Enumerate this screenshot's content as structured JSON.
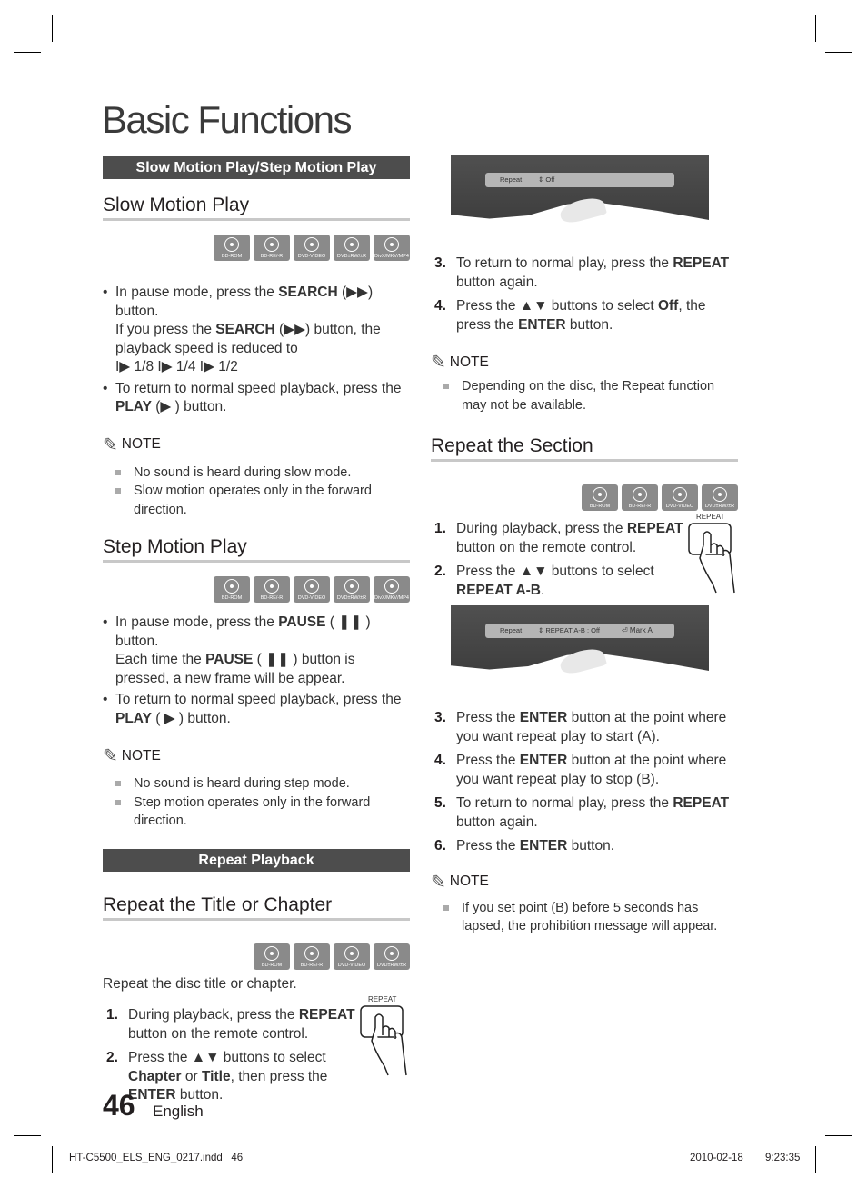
{
  "page_title": "Basic Functions",
  "left": {
    "banner1": "Slow Motion Play/Step Motion Play",
    "slow": {
      "heading": "Slow Motion Play",
      "discs": [
        "BD-ROM",
        "BD-RE/-R",
        "DVD-VIDEO",
        "DVD±RW/±R",
        "DivX/MKV/MP4"
      ],
      "b1_pre": "In pause mode, press the ",
      "b1_bold": "SEARCH",
      "b1_post": " (▶▶) button.",
      "b1_line2_pre": "If you press the ",
      "b1_line2_bold": "SEARCH",
      "b1_line2_post": " (▶▶) button, the playback speed is reduced to",
      "b1_speeds": "I▶ 1/8 I▶ 1/4 I▶ 1/2",
      "b2_pre": "To return to normal speed playback, press the ",
      "b2_bold": "PLAY",
      "b2_post": " (▶ ) button.",
      "note_label": "NOTE",
      "notes": [
        "No sound is heard during slow mode.",
        "Slow motion operates only in the forward direction."
      ]
    },
    "step": {
      "heading": "Step Motion Play",
      "discs": [
        "BD-ROM",
        "BD-RE/-R",
        "DVD-VIDEO",
        "DVD±RW/±R",
        "DivX/MKV/MP4"
      ],
      "b1_pre": "In pause mode, press the ",
      "b1_bold": "PAUSE",
      "b1_post": " ( ❚❚ ) button.",
      "b1_line2_pre": "Each time the ",
      "b1_line2_bold": "PAUSE",
      "b1_line2_post": " ( ❚❚ ) button is pressed, a new frame will be appear.",
      "b2_pre": "To return to normal speed playback, press the ",
      "b2_bold": "PLAY",
      "b2_post": " ( ▶ ) button.",
      "note_label": "NOTE",
      "notes": [
        "No sound is heard during step mode.",
        "Step motion operates only in the forward direction."
      ]
    },
    "banner2": "Repeat Playback",
    "title_chapter": {
      "heading": "Repeat the Title or Chapter",
      "discs": [
        "BD-ROM",
        "BD-RE/-R",
        "DVD-VIDEO",
        "DVD±RW/±R"
      ],
      "intro": "Repeat the disc title or chapter.",
      "remote_label": "REPEAT",
      "s1_num": "1.",
      "s1_pre": "During playback, press the ",
      "s1_bold": "REPEAT",
      "s1_post": " button on the remote control.",
      "s2_num": "2.",
      "s2_pre": "Press the ▲▼ buttons to select ",
      "s2_b1": "Chapter",
      "s2_mid": " or ",
      "s2_b2": "Title",
      "s2_mid2": ", then press the ",
      "s2_b3": "ENTER",
      "s2_post": " button."
    }
  },
  "right": {
    "osd1": {
      "label": "Repeat",
      "value": "⇕ Off"
    },
    "s3_num": "3.",
    "s3_pre": "To return to normal play, press the ",
    "s3_bold": "REPEAT",
    "s3_post": " button again.",
    "s4_num": "4.",
    "s4_pre": "Press the ▲▼ buttons to select ",
    "s4_bold": "Off",
    "s4_mid": ", the press the ",
    "s4_bold2": "ENTER",
    "s4_post": " button.",
    "note1_label": "NOTE",
    "note1": "Depending on the disc, the Repeat function may not be available.",
    "section": {
      "heading": "Repeat the Section",
      "discs": [
        "BD-ROM",
        "BD-RE/-R",
        "DVD-VIDEO",
        "DVD±RW/±R"
      ],
      "remote_label": "REPEAT",
      "steps": [
        {
          "num": "1.",
          "pre": "During playback, press the ",
          "bold": "REPEAT",
          "post": " button on the remote control."
        },
        {
          "num": "2.",
          "pre": "Press the ▲▼ buttons to select ",
          "bold": "REPEAT A-B",
          "post": "."
        }
      ],
      "osd2": {
        "label": "Repeat",
        "value": "⇕ REPEAT A-B : Off",
        "mark": "⏎ Mark A"
      },
      "steps2": [
        {
          "num": "3.",
          "pre": "Press the ",
          "bold": "ENTER",
          "post": " button at the point where you want repeat play to start (A)."
        },
        {
          "num": "4.",
          "pre": "Press the ",
          "bold": "ENTER",
          "post": " button at the point where you want repeat play to stop (B)."
        },
        {
          "num": "5.",
          "pre": "To return to normal play, press the ",
          "bold": "REPEAT",
          "post": " button again."
        },
        {
          "num": "6.",
          "pre": "Press the ",
          "bold": "ENTER",
          "post": " button."
        }
      ],
      "note_label": "NOTE",
      "note": "If you set point (B) before 5 seconds has lapsed, the prohibition message will appear."
    }
  },
  "footer": {
    "page_number": "46",
    "language": "English",
    "slug_file": "HT-C5500_ELS_ENG_0217.indd   46",
    "slug_date": "2010-02-18",
    "slug_time": "9:23:35"
  }
}
